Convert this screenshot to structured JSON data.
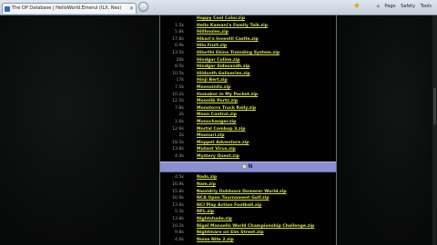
{
  "browser": {
    "tab_title": "The OP Database | HelloWorld.Emerul (ILX, Nes)",
    "menu": [
      "Page",
      "Safety",
      "Tools"
    ]
  },
  "listing": {
    "rows_before": [
      {
        "size": "",
        "name": "Happy Cool Color.zip"
      },
      {
        "size": "1.5k",
        "name": "Hello Kamani's Family Talk.zip"
      },
      {
        "size": "5.8k",
        "name": "Hillhnoles.zip"
      },
      {
        "size": "17.8k",
        "name": "Hikari's Inventil Castle.zip"
      },
      {
        "size": "6.9k",
        "name": "Hilo Fruit.zip"
      },
      {
        "size": "13.5k",
        "name": "Hilorthi Ekino Trainding System.zip"
      },
      {
        "size": "20k",
        "name": "Hindgar Coline.zip"
      },
      {
        "size": "8.5k",
        "name": "Hindgar Sidesandh.zip"
      },
      {
        "size": "10.5k",
        "name": "Hildonth Galixeries.zip"
      },
      {
        "size": "17k",
        "name": "Hinji Bert.zip"
      },
      {
        "size": "7.5k",
        "name": "Moonsinitz.zip"
      },
      {
        "size": "10.2k",
        "name": "Homakor in My Pocket.zip"
      },
      {
        "size": "12.5k",
        "name": "Moonlib Portz.zip"
      },
      {
        "size": "7.8k",
        "name": "Monstorrs Truck Rally.zip"
      },
      {
        "size": "2k",
        "name": "Moon Control.zip"
      },
      {
        "size": "1.6k",
        "name": "Monschanger.zip"
      },
      {
        "size": "12.6k",
        "name": "Mortal Combop 3.zip"
      },
      {
        "size": "2k",
        "name": "Moonuri.zip"
      },
      {
        "size": "18.5k",
        "name": "Moppet Adventure.zip"
      },
      {
        "size": "13.8k",
        "name": "Mutant Virus.zip"
      },
      {
        "size": "4.4k",
        "name": "Mystery Quest.zip"
      }
    ],
    "section_letter": "N",
    "rows_after": [
      {
        "size": "4.5k",
        "name": "Nads.zip"
      },
      {
        "size": "16.9k",
        "name": "Nam.zip"
      },
      {
        "size": "15.8k",
        "name": "Nwoldriy Outdoors Domerer World.zip"
      },
      {
        "size": "16.9k",
        "name": "NCA Open Tournament Golf.zip"
      },
      {
        "size": "13.6k",
        "name": "NCI Play Action Football.zip"
      },
      {
        "size": "5.5k",
        "name": "NFL.zip"
      },
      {
        "size": "13.8k",
        "name": "Nightshade.zip"
      },
      {
        "size": "10.2k",
        "name": "Nigel Mansells World Championship Challenge.zip"
      },
      {
        "size": "9.8k",
        "name": "Nightmare on Elm Street.zip"
      },
      {
        "size": "4.6k",
        "name": "Noise Nite 2.zip"
      }
    ]
  }
}
